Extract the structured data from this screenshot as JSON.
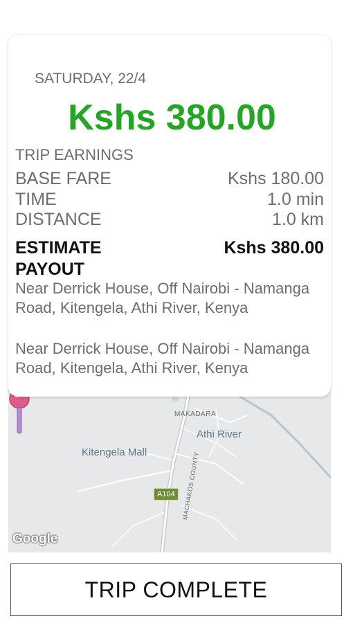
{
  "trip": {
    "date": "SATURDAY, 22/4",
    "total": "Kshs 380.00",
    "section_title": "TRIP EARNINGS",
    "rows": [
      {
        "label": "BASE FARE",
        "value": "Kshs 180.00"
      },
      {
        "label": "TIME",
        "value": "1.0 min"
      },
      {
        "label": "DISTANCE",
        "value": "1.0 km"
      }
    ],
    "payout": {
      "label": "ESTIMATE PAYOUT",
      "value": "Kshs 380.00"
    },
    "pickup_address": "Near Derrick House, Off Nairobi - Namanga Road, Kitengela, Athi River, Kenya",
    "dropoff_address": "Near Derrick House, Off Nairobi - Namanga Road, Kitengela, Athi River, Kenya"
  },
  "map": {
    "labels": {
      "makadara": "MAKADARA",
      "athi_river": "Athi River",
      "kitengela_mall": "Kitengela Mall",
      "road_badge": "A104",
      "machakos": "MACHAKOS COUNTY"
    },
    "attribution": "Google",
    "pin_icon": "location-pin-icon"
  },
  "actions": {
    "complete_label": "TRIP COMPLETE"
  },
  "colors": {
    "total_green": "#23a623",
    "pin_pink": "#e05a8a",
    "map_bg": "#e6e8ea"
  }
}
